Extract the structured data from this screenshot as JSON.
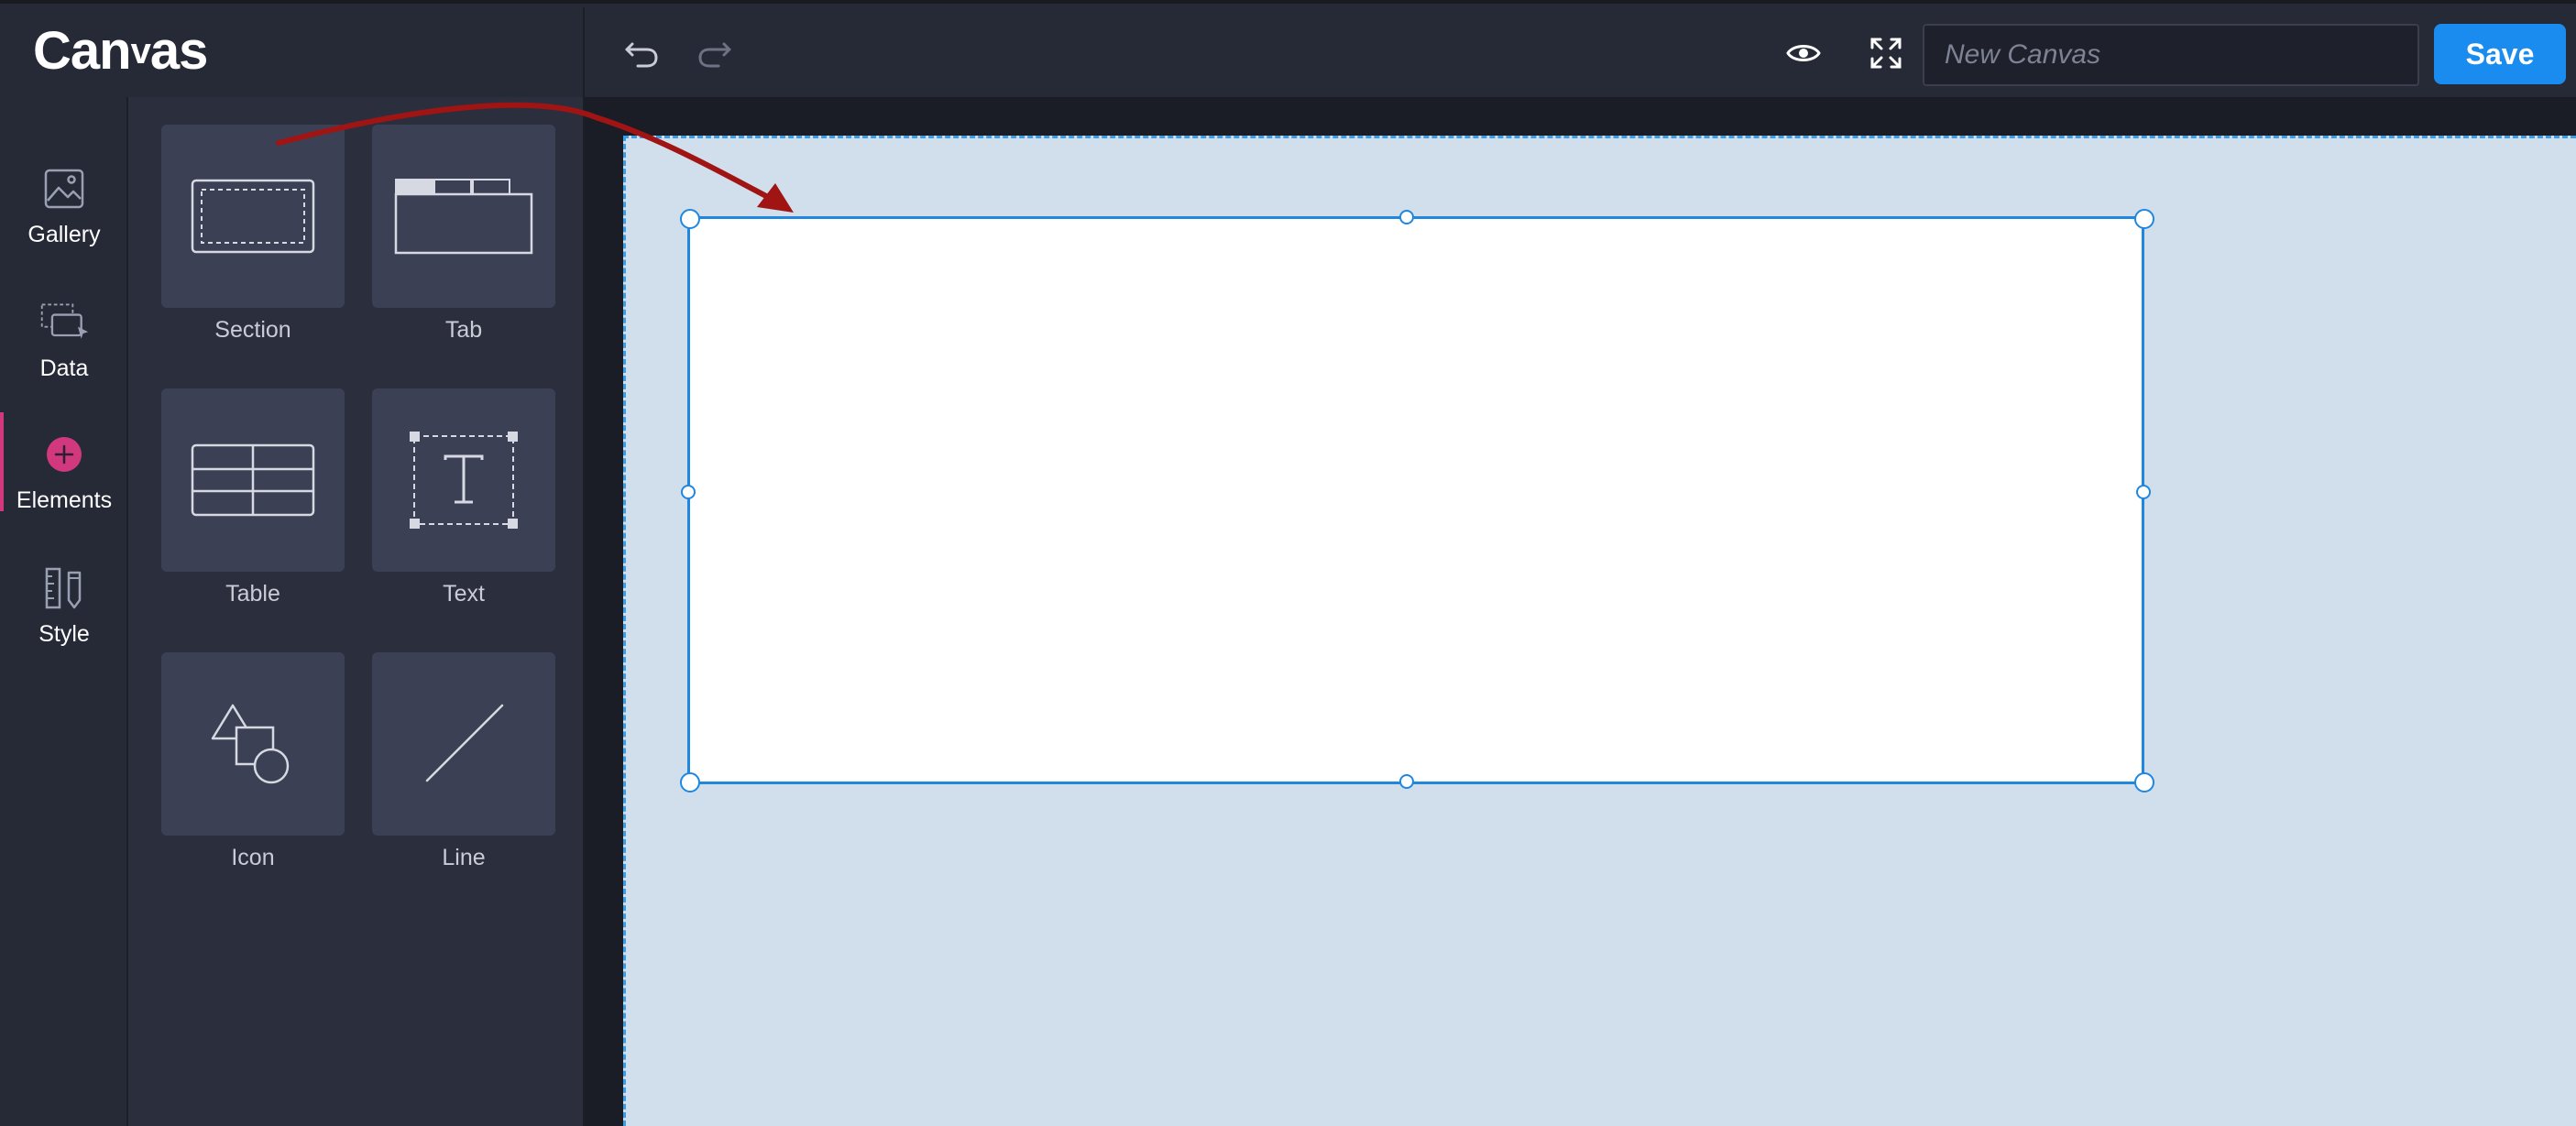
{
  "app": {
    "logo_text_before": "Can",
    "logo_text_v": "v",
    "logo_text_after": "as"
  },
  "toolbar": {
    "undo_icon": "undo-icon",
    "redo_icon": "redo-icon",
    "preview_icon": "eye-icon",
    "fullscreen_icon": "expand-icon",
    "canvas_name_placeholder": "New Canvas",
    "save_label": "Save"
  },
  "rail": {
    "items": [
      {
        "label": "Gallery",
        "icon": "image-icon"
      },
      {
        "label": "Data",
        "icon": "data-icon"
      },
      {
        "label": "Elements",
        "icon": "plus-circle-icon",
        "active": true
      },
      {
        "label": "Style",
        "icon": "ruler-pencil-icon"
      }
    ]
  },
  "elements_panel": {
    "tiles": [
      {
        "label": "Section",
        "icon": "section-icon"
      },
      {
        "label": "Tab",
        "icon": "tab-icon"
      },
      {
        "label": "Table",
        "icon": "table-icon"
      },
      {
        "label": "Text",
        "icon": "text-icon"
      },
      {
        "label": "Icon",
        "icon": "shapes-icon"
      },
      {
        "label": "Line",
        "icon": "line-icon"
      }
    ]
  },
  "colors": {
    "accent": "#1a8cf0",
    "active_rail": "#d1387e",
    "annotation_arrow": "#a01414",
    "artboard_bg": "#d0dfeb"
  }
}
